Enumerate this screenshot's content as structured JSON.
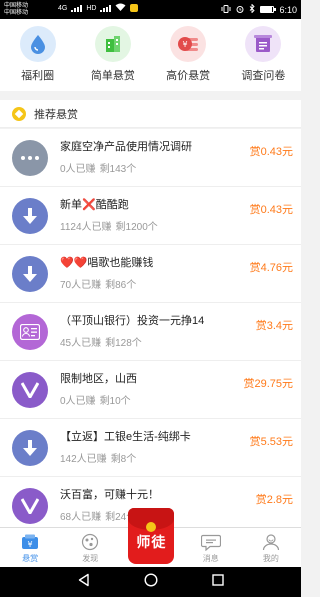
{
  "status_bar": {
    "carrier_1": "中国移动",
    "carrier_2": "中国移动",
    "network_1": "4G",
    "network_2": "HD",
    "time": "6:10",
    "battery_level": 0.85
  },
  "categories": [
    {
      "label": "福利圈",
      "icon": "water-drop-icon",
      "color": "#4a90e2",
      "bg": "#dcebfb"
    },
    {
      "label": "简单悬赏",
      "icon": "building-icon",
      "color": "#3fbf3f",
      "bg": "#e3f6e3"
    },
    {
      "label": "高价悬赏",
      "icon": "coin-stack-icon",
      "color": "#e24b4b",
      "bg": "#fbe2e2"
    },
    {
      "label": "调查问卷",
      "icon": "document-icon",
      "color": "#9b5ac9",
      "bg": "#efe3f8"
    }
  ],
  "section": {
    "title": "推荐悬赏"
  },
  "tasks": [
    {
      "title": "家庭空净产品使用情况调研",
      "earned": "0人已赚",
      "remaining": "剩143个",
      "reward": "赏0.43元",
      "avatar": "more-dots-icon",
      "color": "#8a96a8"
    },
    {
      "title": "新单❌酷酷跑",
      "earned": "1124人已赚",
      "remaining": "剩1200个",
      "reward": "赏0.43元",
      "avatar": "download-icon",
      "color": "#6b7ec9"
    },
    {
      "title": "❤️❤️唱歌也能赚钱",
      "earned": "70人已赚",
      "remaining": "剩86个",
      "reward": "赏4.76元",
      "avatar": "download-icon",
      "color": "#6b7ec9"
    },
    {
      "title": "（平顶山银行）投资一元挣14",
      "earned": "45人已赚",
      "remaining": "剩128个",
      "reward": "赏3.4元",
      "avatar": "contact-card-icon",
      "color": "#b367d6"
    },
    {
      "title": "限制地区，山西",
      "earned": "0人已赚",
      "remaining": "剩10个",
      "reward": "赏29.75元",
      "avatar": "v-badge-icon",
      "color": "#8a5bc9"
    },
    {
      "title": "【立返】工银e生活-纯绑卡",
      "earned": "142人已赚",
      "remaining": "剩8个",
      "reward": "赏5.53元",
      "avatar": "download-icon",
      "color": "#6b7ec9"
    },
    {
      "title": "沃百富，可赚十元！",
      "earned": "68人已赚",
      "remaining": "剩24个",
      "reward": "赏2.8元",
      "avatar": "v-badge-icon",
      "color": "#8a5bc9"
    }
  ],
  "bottom_nav": {
    "items": [
      {
        "label": "悬赏",
        "icon": "bounty-icon",
        "active": true
      },
      {
        "label": "发现",
        "icon": "discover-icon",
        "active": false
      },
      {
        "label": "消息",
        "icon": "message-icon",
        "active": false
      },
      {
        "label": "我的",
        "icon": "profile-icon",
        "active": false
      }
    ],
    "center_label": "师徒"
  }
}
